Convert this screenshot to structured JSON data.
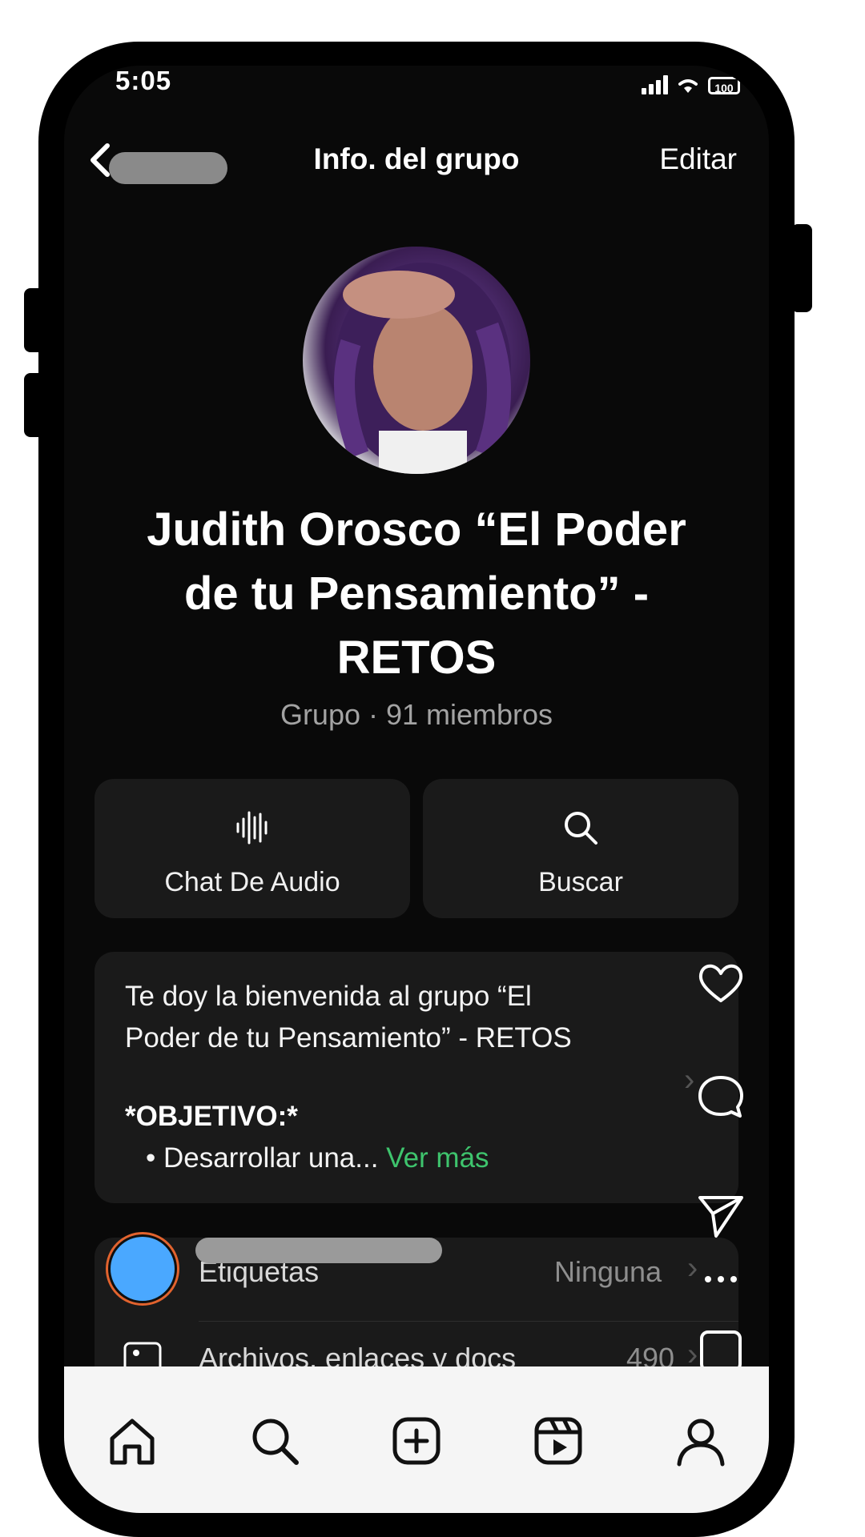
{
  "status_bar": {
    "time": "5:05",
    "battery": "100"
  },
  "header": {
    "title": "Info. del grupo",
    "edit_label": "Editar"
  },
  "group": {
    "name": "Judith Orosco “El Poder\nde tu Pensamiento” -\nRETOS",
    "meta": "Grupo · 91 miembros"
  },
  "actions": [
    {
      "label": "Chat De Audio",
      "icon": "audio-wave-icon"
    },
    {
      "label": "Buscar",
      "icon": "search-icon"
    }
  ],
  "description": {
    "text": "Te doy la bienvenida  al grupo “El\nPoder de tu Pensamiento” - RETOS",
    "objective": "*OBJETIVO:*",
    "bullet": "• Desarrollar una... ",
    "more": "Ver más"
  },
  "list": [
    {
      "label": "Etiquetas",
      "value": "Ninguna"
    },
    {
      "label": "Archivos, enlaces y docs",
      "value": "490"
    }
  ],
  "right_rail": [
    "heart-icon",
    "comment-icon",
    "send-icon",
    "more-icon",
    "bookmark-icon"
  ],
  "bottom_nav": [
    "home-icon",
    "search-icon",
    "create-icon",
    "reels-icon",
    "profile-icon"
  ],
  "colors": {
    "accent_green": "#3ec46d",
    "story_ring": "#e2632e",
    "story_dot": "#4aa8ff"
  }
}
